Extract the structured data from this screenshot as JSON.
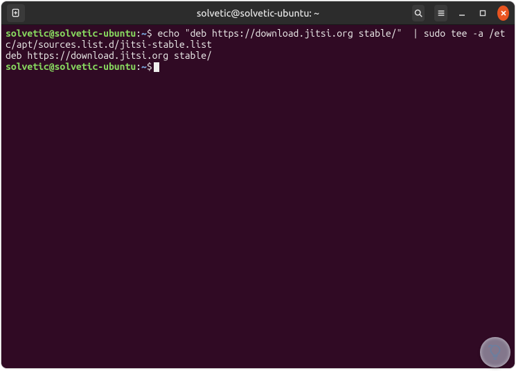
{
  "title_bar": {
    "title": "solvetic@solvetic-ubuntu: ~"
  },
  "terminal": {
    "background": "#300a24",
    "prompt": {
      "user_host": "solvetic@solvetic-ubuntu",
      "separator": ":",
      "path": "~",
      "symbol": "$"
    },
    "lines": [
      {
        "type": "command",
        "command": "echo \"deb https://download.jitsi.org stable/\"  | sudo tee -a /etc/apt/sources.list.d/jitsi-stable.list"
      },
      {
        "type": "output",
        "text": "deb https://download.jitsi.org stable/"
      },
      {
        "type": "prompt-only"
      }
    ]
  },
  "icons": {
    "new_tab": "new-tab",
    "search": "search",
    "menu": "menu",
    "minimize": "minimize",
    "maximize": "maximize",
    "close": "close",
    "watermark": "lightbulb"
  }
}
